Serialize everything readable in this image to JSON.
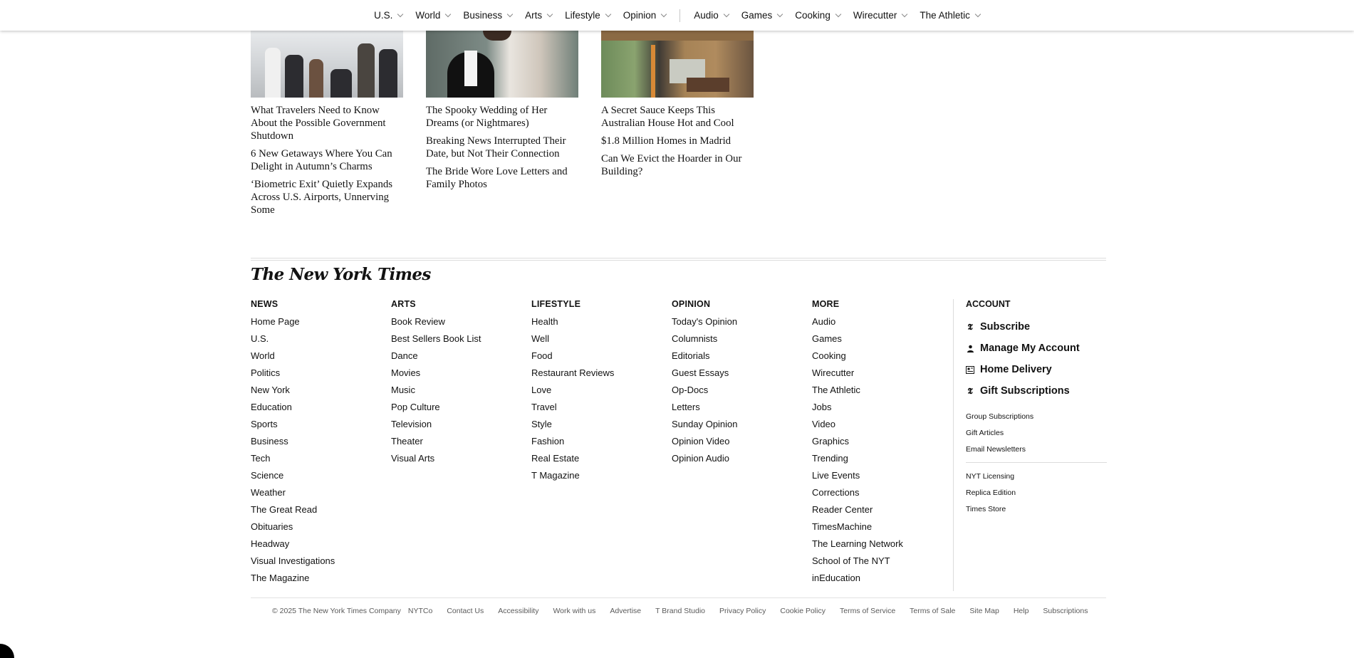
{
  "nav": {
    "items": [
      "U.S.",
      "World",
      "Business",
      "Arts",
      "Lifestyle",
      "Opinion"
    ],
    "items2": [
      "Audio",
      "Games",
      "Cooking",
      "Wirecutter",
      "The Athletic"
    ]
  },
  "stories": [
    {
      "image": "travelers-airport-photo",
      "headline": "What Travelers Need to Know About the Possible Government Shutdown",
      "subs": [
        "6 New Getaways Where You Can Delight in Autumn’s Charms",
        "‘Biometric Exit’ Quietly Expands Across U.S. Airports, Unnerving Some"
      ]
    },
    {
      "image": "wedding-couple-photo",
      "headline": "The Spooky Wedding of Her Dreams (or Nightmares)",
      "subs": [
        "Breaking News Interrupted Their Date, but Not Their Connection",
        "The Bride Wore Love Letters and Family Photos"
      ]
    },
    {
      "image": "australian-house-photo",
      "headline": "A Secret Sauce Keeps This Australian House Hot and Cool",
      "subs": [
        "$1.8 Million Homes in Madrid",
        "Can We Evict the Hoarder in Our Building?"
      ]
    }
  ],
  "footer": {
    "logo": "The New York Times",
    "columns": [
      {
        "title": "NEWS",
        "links": [
          "Home Page",
          "U.S.",
          "World",
          "Politics",
          "New York",
          "Education",
          "Sports",
          "Business",
          "Tech",
          "Science",
          "Weather",
          "The Great Read",
          "Obituaries",
          "Headway",
          "Visual Investigations",
          "The Magazine"
        ]
      },
      {
        "title": "ARTS",
        "links": [
          "Book Review",
          "Best Sellers Book List",
          "Dance",
          "Movies",
          "Music",
          "Pop Culture",
          "Television",
          "Theater",
          "Visual Arts"
        ]
      },
      {
        "title": "LIFESTYLE",
        "links": [
          "Health",
          "Well",
          "Food",
          "Restaurant Reviews",
          "Love",
          "Travel",
          "Style",
          "Fashion",
          "Real Estate",
          "T Magazine"
        ]
      },
      {
        "title": "OPINION",
        "links": [
          "Today's Opinion",
          "Columnists",
          "Editorials",
          "Guest Essays",
          "Op-Docs",
          "Letters",
          "Sunday Opinion",
          "Opinion Video",
          "Opinion Audio"
        ]
      },
      {
        "title": "MORE",
        "links": [
          "Audio",
          "Games",
          "Cooking",
          "Wirecutter",
          "The Athletic",
          "Jobs",
          "Video",
          "Graphics",
          "Trending",
          "Live Events",
          "Corrections",
          "Reader Center",
          "TimesMachine",
          "The Learning Network",
          "School of The NYT",
          "inEducation"
        ]
      }
    ],
    "account": {
      "title": "ACCOUNT",
      "main": [
        {
          "label": "Subscribe",
          "icon": "nyt-t-icon"
        },
        {
          "label": "Manage My Account",
          "icon": "person-icon"
        },
        {
          "label": "Home Delivery",
          "icon": "newspaper-icon"
        },
        {
          "label": "Gift Subscriptions",
          "icon": "nyt-t-icon"
        }
      ],
      "small1": [
        "Group Subscriptions",
        "Gift Articles",
        "Email Newsletters"
      ],
      "small2": [
        "NYT Licensing",
        "Replica Edition",
        "Times Store"
      ]
    },
    "bottom": {
      "copyright": "© 2025 The New York Times Company",
      "links": [
        "NYTCo",
        "Contact Us",
        "Accessibility",
        "Work with us",
        "Advertise",
        "T Brand Studio",
        "Privacy Policy",
        "Cookie Policy",
        "Terms of Service",
        "Terms of Sale",
        "Site Map",
        "Help",
        "Subscriptions"
      ]
    }
  }
}
